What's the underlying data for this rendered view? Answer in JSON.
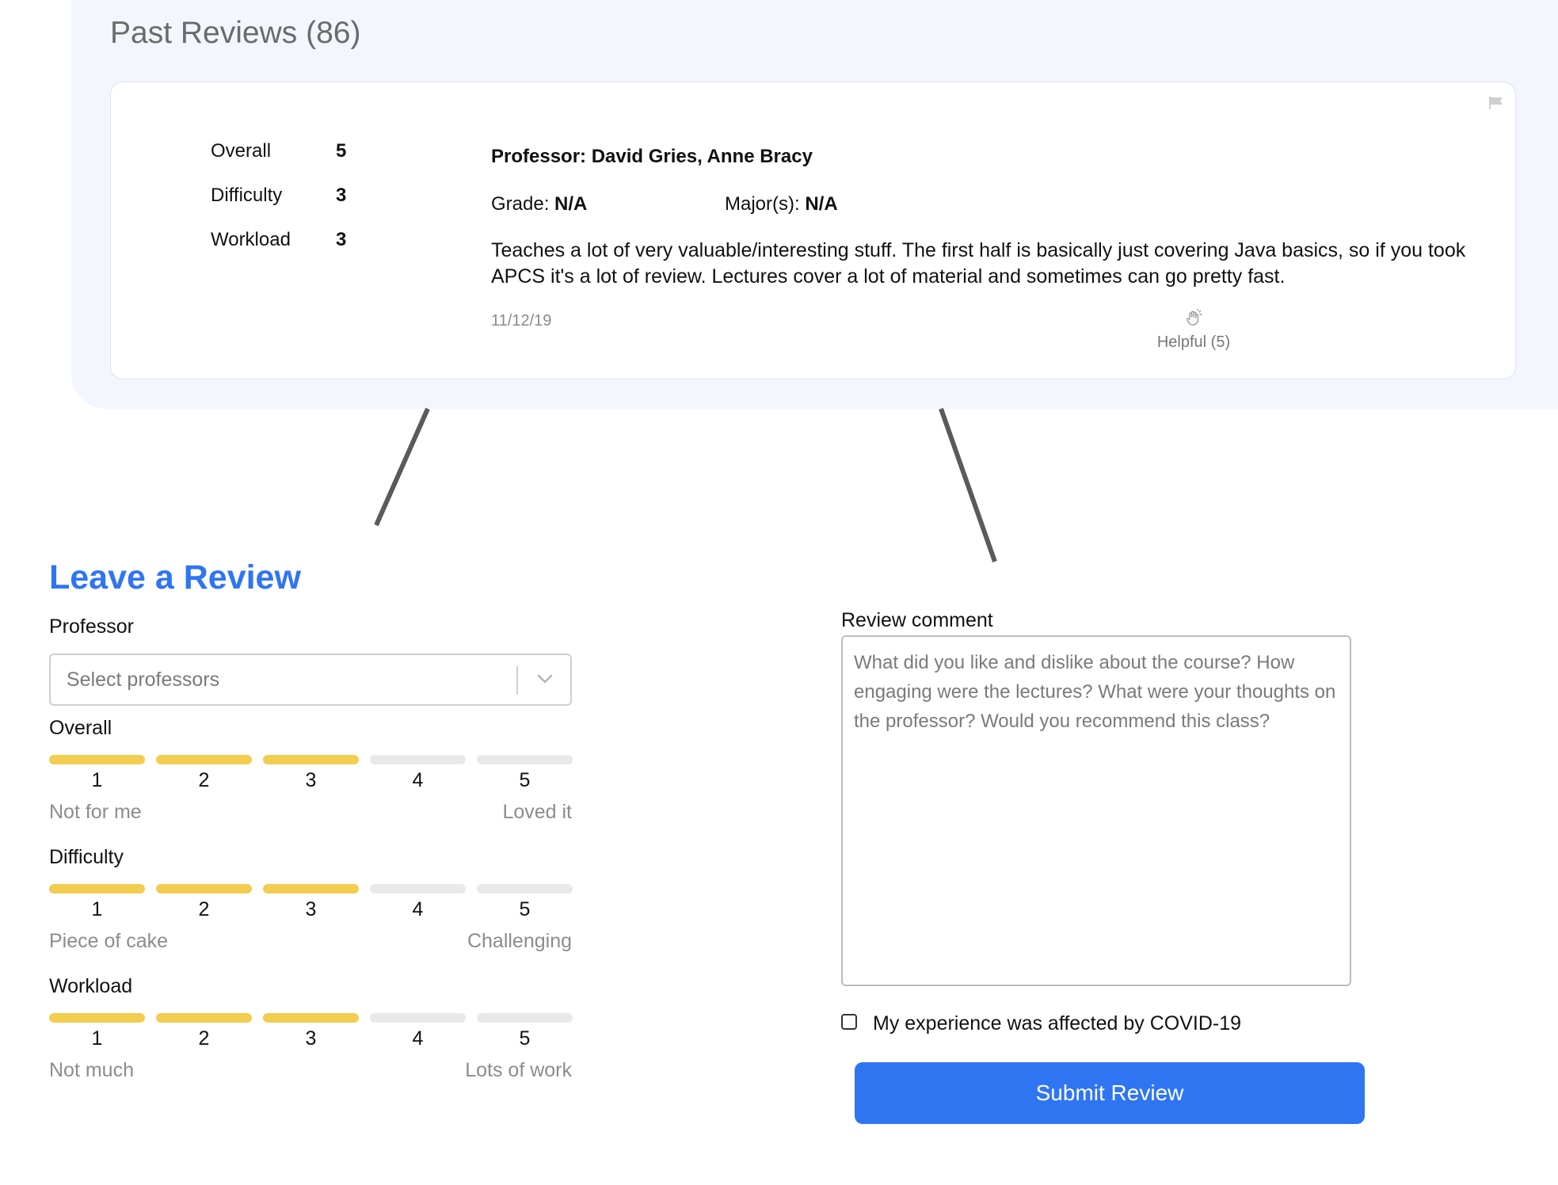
{
  "past_reviews": {
    "title": "Past Reviews (86)",
    "review": {
      "ratings": [
        {
          "label": "Overall",
          "value": "5"
        },
        {
          "label": "Difficulty",
          "value": "3"
        },
        {
          "label": "Workload",
          "value": "3"
        }
      ],
      "professor_label": "Professor:",
      "professor_value": "David Gries, Anne Bracy",
      "grade_label": "Grade:",
      "grade_value": "N/A",
      "majors_label": "Major(s):",
      "majors_value": "N/A",
      "text": "Teaches a lot of very valuable/interesting stuff. The first half is basically just covering Java basics, so if you took APCS it's a lot of review. Lectures cover a lot of material and sometimes can go pretty fast.",
      "date": "11/12/19",
      "helpful_label": "Helpful (5)",
      "helpful_icon": "clapping-hand-icon",
      "flag_icon": "flag-icon"
    }
  },
  "leave_review": {
    "title": "Leave a Review",
    "professor_label": "Professor",
    "professor_placeholder": "Select professors",
    "scales": [
      {
        "label": "Overall",
        "selected": 3,
        "numbers": [
          "1",
          "2",
          "3",
          "4",
          "5"
        ],
        "low": "Not for me",
        "high": "Loved it"
      },
      {
        "label": "Difficulty",
        "selected": 3,
        "numbers": [
          "1",
          "2",
          "3",
          "4",
          "5"
        ],
        "low": "Piece of cake",
        "high": "Challenging"
      },
      {
        "label": "Workload",
        "selected": 3,
        "numbers": [
          "1",
          "2",
          "3",
          "4",
          "5"
        ],
        "low": "Not much",
        "high": "Lots of work"
      }
    ],
    "comment_label": "Review comment",
    "comment_placeholder": "What did you like and dislike about the course? How engaging were the lectures? What were your thoughts on the professor? Would you recommend this class?",
    "covid_label": "My experience was affected by COVID-19",
    "covid_checked": false,
    "submit_label": "Submit Review"
  },
  "colors": {
    "accent": "#2f75f2",
    "rating_on": "#f2cd4f",
    "rating_off": "#e9e9e9",
    "panel_bg": "#f3f6fc"
  }
}
